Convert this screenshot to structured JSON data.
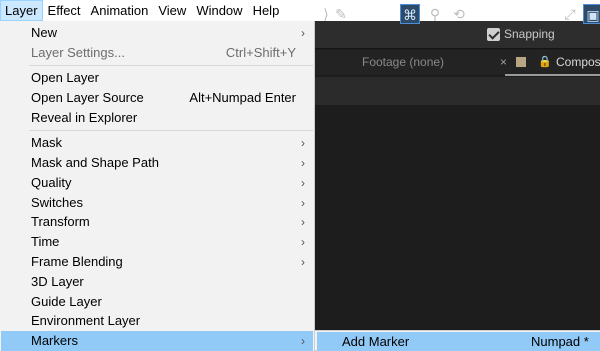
{
  "menubar": {
    "items": [
      "Layer",
      "Effect",
      "Animation",
      "View",
      "Window",
      "Help"
    ]
  },
  "toolbar": {
    "snapping_label": "Snapping",
    "snapping_checked": true
  },
  "panel": {
    "footage_tab": "Footage (none)",
    "close_glyph": "×",
    "comp_tab": "Composi",
    "swatch_color": "#b8a582"
  },
  "layer_menu": {
    "items": [
      {
        "label": "New",
        "submenu": true
      },
      {
        "label": "Layer Settings...",
        "shortcut": "Ctrl+Shift+Y",
        "disabled": true
      },
      {
        "label": "Open Layer"
      },
      {
        "label": "Open Layer Source",
        "shortcut": "Alt+Numpad Enter"
      },
      {
        "label": "Reveal in Explorer"
      },
      {
        "label": "Mask",
        "submenu": true
      },
      {
        "label": "Mask and Shape Path",
        "submenu": true
      },
      {
        "label": "Quality",
        "submenu": true
      },
      {
        "label": "Switches",
        "submenu": true
      },
      {
        "label": "Transform",
        "submenu": true
      },
      {
        "label": "Time",
        "submenu": true
      },
      {
        "label": "Frame Blending",
        "submenu": true
      },
      {
        "label": "3D Layer"
      },
      {
        "label": "Guide Layer"
      },
      {
        "label": "Environment Layer"
      },
      {
        "label": "Markers",
        "submenu": true,
        "highlighted": true
      }
    ]
  },
  "markers_submenu": {
    "items": [
      {
        "label": "Add Marker",
        "shortcut": "Numpad *"
      }
    ]
  },
  "colors": {
    "highlight": "#91c9f7",
    "menubar_active": "#cce8ff"
  }
}
